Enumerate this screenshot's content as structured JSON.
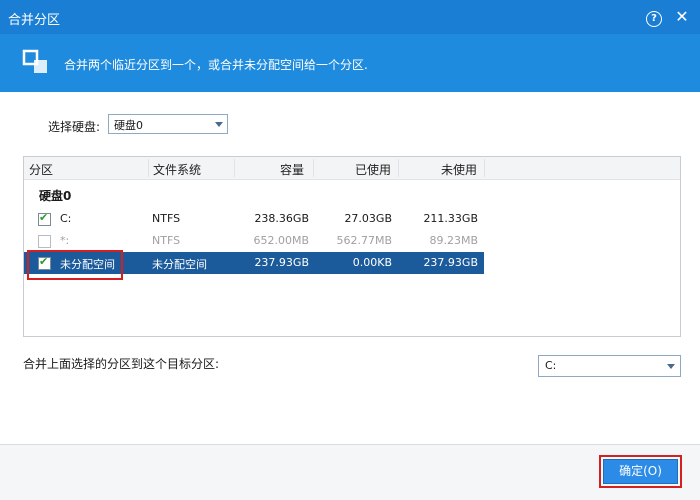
{
  "window": {
    "title": "合并分区",
    "help_glyph": "?",
    "close_glyph": "✕"
  },
  "banner": {
    "text": "合并两个临近分区到一个，或合并未分配空间给一个分区.",
    "icon": "merge-partition-icon"
  },
  "disk_select": {
    "label": "选择硬盘:",
    "value": "硬盘0"
  },
  "table": {
    "columns": [
      "分区",
      "文件系统",
      "容量",
      "已使用",
      "未使用"
    ],
    "group": "硬盘0",
    "rows": [
      {
        "partition": "C:",
        "fs": "NTFS",
        "capacity": "238.36GB",
        "used": "27.03GB",
        "free": "211.33GB",
        "checked": true,
        "state": "normal"
      },
      {
        "partition": "*:",
        "fs": "NTFS",
        "capacity": "652.00MB",
        "used": "562.77MB",
        "free": "89.23MB",
        "checked": false,
        "state": "disabled"
      },
      {
        "partition": "未分配空间",
        "fs": "未分配空间",
        "capacity": "237.93GB",
        "used": "0.00KB",
        "free": "237.93GB",
        "checked": true,
        "state": "selected"
      }
    ]
  },
  "target": {
    "label": "合并上面选择的分区到这个目标分区:",
    "value": "C:"
  },
  "footer": {
    "ok_label": "确定(O)"
  },
  "colors": {
    "titlebar": "#1a7fd4",
    "banner": "#1e8bde",
    "selection": "#1c5b9b",
    "highlight_box": "#d42020",
    "ok_button": "#2b8be6"
  }
}
